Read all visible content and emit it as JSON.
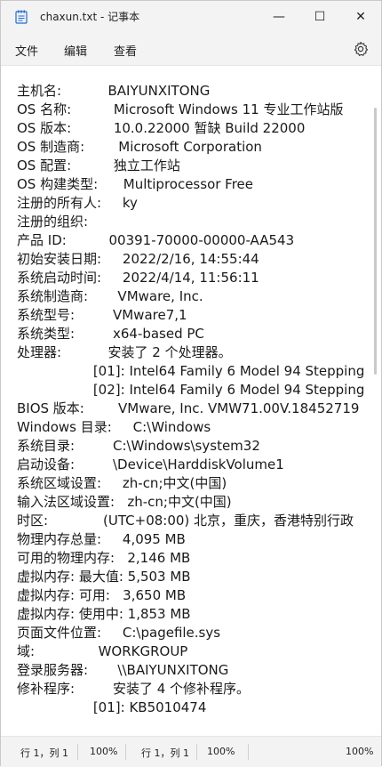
{
  "titlebar": {
    "title": "chaxun.txt - 记事本",
    "minimize_glyph": "—",
    "maximize_glyph": "☐",
    "close_glyph": "✕"
  },
  "menu": {
    "file": "文件",
    "edit": "编辑",
    "view": "查看",
    "settings_icon": "gear-icon"
  },
  "content": {
    "lines": [
      "主机名:           BAIYUNXITONG",
      "OS 名称:          Microsoft Windows 11 专业工作站版",
      "OS 版本:          10.0.22000 暂缺 Build 22000",
      "OS 制造商:        Microsoft Corporation",
      "OS 配置:          独立工作站",
      "OS 构建类型:      Multiprocessor Free",
      "注册的所有人:     ky",
      "注册的组织:",
      "产品 ID:          00391-70000-00000-AA543",
      "初始安装日期:     2022/2/16, 14:55:44",
      "系统启动时间:     2022/4/14, 11:56:11",
      "系统制造商:       VMware, Inc.",
      "系统型号:         VMware7,1",
      "系统类型:         x64-based PC",
      "处理器:           安装了 2 个处理器。",
      "                  [01]: Intel64 Family 6 Model 94 Stepping",
      "                  [02]: Intel64 Family 6 Model 94 Stepping",
      "BIOS 版本:        VMware, Inc. VMW71.00V.18452719",
      "Windows 目录:     C:\\Windows",
      "系统目录:         C:\\Windows\\system32",
      "启动设备:         \\Device\\HarddiskVolume1",
      "系统区域设置:     zh-cn;中文(中国)",
      "输入法区域设置:   zh-cn;中文(中国)",
      "时区:             (UTC+08:00) 北京，重庆，香港特别行政",
      "物理内存总量:     4,095 MB",
      "可用的物理内存:   2,146 MB",
      "虚拟内存: 最大值: 5,503 MB",
      "虚拟内存: 可用:   3,650 MB",
      "虚拟内存: 使用中: 1,853 MB",
      "页面文件位置:     C:\\pagefile.sys",
      "域:               WORKGROUP",
      "登录服务器:       \\\\BAIYUNXITONG",
      "修补程序:         安装了 4 个修补程序。",
      "                  [01]: KB5010474"
    ]
  },
  "status": {
    "position": "行 1，列 1",
    "zoom": "100%",
    "position2": "行 1，列 1",
    "zoom2": "100%",
    "encoding": "100%"
  }
}
